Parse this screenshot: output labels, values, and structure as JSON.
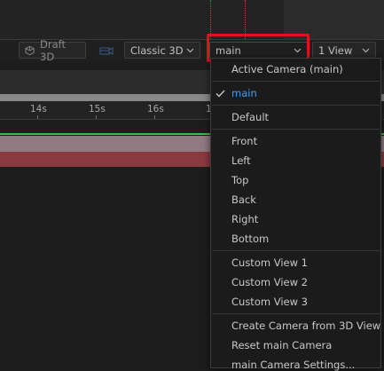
{
  "toolbar": {
    "draft3d_label": "Draft 3D",
    "renderer_value": "Classic 3D",
    "camera_value": "main",
    "views_value": "1 View"
  },
  "timeline": {
    "ticks": [
      "14s",
      "15s",
      "16s",
      "1"
    ]
  },
  "camera_menu": {
    "items": [
      {
        "label": "Active Camera (main)",
        "checked": false
      },
      {
        "label": "main",
        "checked": true
      },
      {
        "label": "Default",
        "checked": false
      },
      {
        "label": "Front",
        "checked": false
      },
      {
        "label": "Left",
        "checked": false
      },
      {
        "label": "Top",
        "checked": false
      },
      {
        "label": "Back",
        "checked": false
      },
      {
        "label": "Right",
        "checked": false
      },
      {
        "label": "Bottom",
        "checked": false
      },
      {
        "label": "Custom View 1",
        "checked": false
      },
      {
        "label": "Custom View 2",
        "checked": false
      },
      {
        "label": "Custom View 3",
        "checked": false
      },
      {
        "label": "Create Camera from 3D View",
        "checked": false
      },
      {
        "label": "Reset main Camera",
        "checked": false
      },
      {
        "label": "main Camera Settings...",
        "checked": false
      }
    ]
  },
  "colors": {
    "highlight": "#e0131b",
    "selected": "#4a9be8",
    "green_line": "#36c23a"
  },
  "icons": [
    "cube-icon",
    "camera-icon",
    "chevron-down-icon",
    "checkmark-icon"
  ]
}
